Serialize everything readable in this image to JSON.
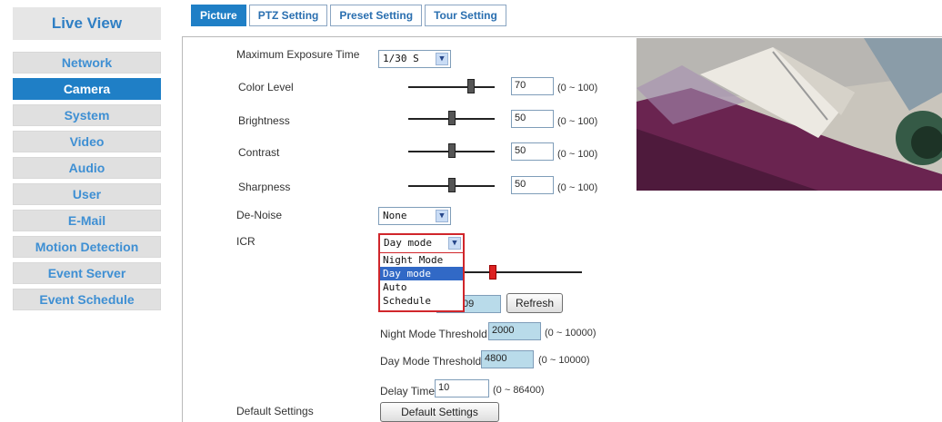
{
  "sidebar": {
    "title": "Live View",
    "items": [
      {
        "label": "Network",
        "active": false
      },
      {
        "label": "Camera",
        "active": true
      },
      {
        "label": "System",
        "active": false
      },
      {
        "label": "Video",
        "active": false
      },
      {
        "label": "Audio",
        "active": false
      },
      {
        "label": "User",
        "active": false
      },
      {
        "label": "E-Mail",
        "active": false
      },
      {
        "label": "Motion Detection",
        "active": false
      },
      {
        "label": "Event Server",
        "active": false
      },
      {
        "label": "Event Schedule",
        "active": false
      }
    ]
  },
  "tabs": [
    {
      "label": "Picture",
      "active": true
    },
    {
      "label": "PTZ Setting",
      "active": false
    },
    {
      "label": "Preset Setting",
      "active": false
    },
    {
      "label": "Tour Setting",
      "active": false
    }
  ],
  "form": {
    "max_exposure": {
      "label": "Maximum Exposure Time",
      "value": "1/30 S"
    },
    "color_level": {
      "label": "Color Level",
      "value": "70",
      "range": "(0 ~ 100)"
    },
    "brightness": {
      "label": "Brightness",
      "value": "50",
      "range": "(0 ~ 100)"
    },
    "contrast": {
      "label": "Contrast",
      "value": "50",
      "range": "(0 ~ 100)"
    },
    "sharpness": {
      "label": "Sharpness",
      "value": "50",
      "range": "(0 ~ 100)"
    },
    "denoise": {
      "label": "De-Noise",
      "value": "None"
    },
    "icr": {
      "label": "ICR",
      "value": "Day mode",
      "options": [
        "Night Mode",
        "Day mode",
        "Auto",
        "Schedule"
      ],
      "highlighted": "Day mode"
    },
    "light_value": {
      "partial_value": "09",
      "refresh_label": "Refresh"
    },
    "night_threshold": {
      "label": "Night Mode Threshold",
      "value": "2000",
      "range": "(0 ~ 10000)"
    },
    "day_threshold": {
      "label": "Day Mode Threshold",
      "value": "4800",
      "range": "(0 ~ 10000)"
    },
    "delay_time": {
      "label": "Delay Time",
      "value": "10",
      "range": "(0 ~ 86400)"
    },
    "default_settings": {
      "label": "Default Settings",
      "button_label": "Default Settings"
    }
  },
  "colors": {
    "accent": "#1f7fc6",
    "nav_text": "#3e8fd3",
    "highlight_border": "#d0262b",
    "threshold_field": "#b9dbea"
  }
}
